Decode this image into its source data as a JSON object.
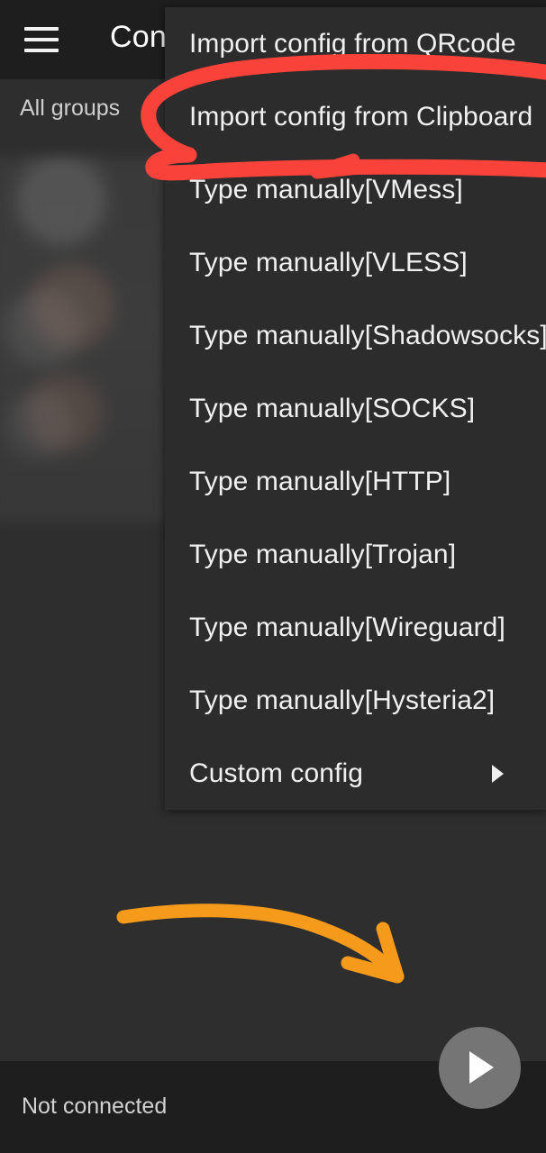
{
  "appbar": {
    "menu_icon": "hamburger-menu-icon",
    "title": "Con"
  },
  "content": {
    "tab_label": "All groups",
    "blurred_note": ""
  },
  "popup_menu": {
    "items": [
      {
        "label": "Import config from QRcode",
        "has_submenu": false
      },
      {
        "label": "Import config from Clipboard",
        "has_submenu": false
      },
      {
        "label": "Type manually[VMess]",
        "has_submenu": false
      },
      {
        "label": "Type manually[VLESS]",
        "has_submenu": false
      },
      {
        "label": "Type manually[Shadowsocks]",
        "has_submenu": false
      },
      {
        "label": "Type manually[SOCKS]",
        "has_submenu": false
      },
      {
        "label": "Type manually[HTTP]",
        "has_submenu": false
      },
      {
        "label": "Type manually[Trojan]",
        "has_submenu": false
      },
      {
        "label": "Type manually[Wireguard]",
        "has_submenu": false
      },
      {
        "label": "Type manually[Hysteria2]",
        "has_submenu": false
      },
      {
        "label": "Custom config",
        "has_submenu": true
      }
    ],
    "submenu_icon": "chevron-right-icon"
  },
  "statusbar": {
    "status": "Not connected"
  },
  "fab": {
    "icon": "play-icon"
  },
  "annotations": {
    "highlight_circle_color": "#f9433a",
    "arrow_color": "#f59a1b",
    "highlight_target": "Import config from Clipboard",
    "arrow_target": "play-fab"
  },
  "colors": {
    "appbar_bg": "#1e1e1e",
    "page_bg": "#2e2e2e",
    "menu_bg": "#2c2c2c",
    "statusbar_bg": "#1e1e1e",
    "fab_bg": "#757575",
    "text_primary": "#f0f0f0",
    "text_secondary": "#cfcfcf"
  }
}
